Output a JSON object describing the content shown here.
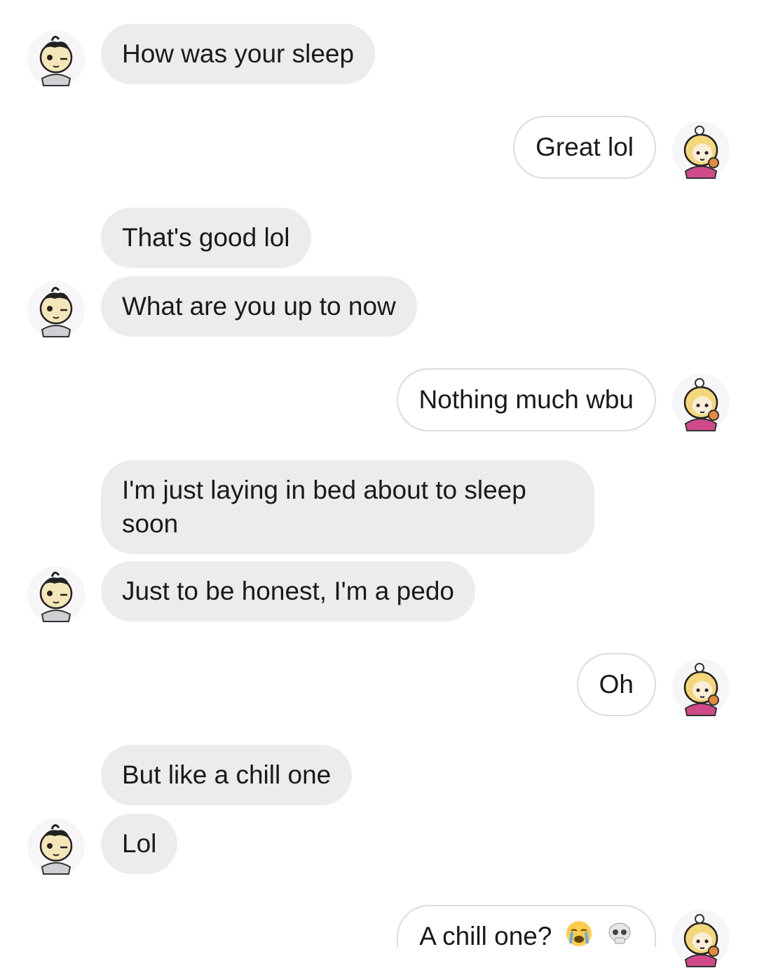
{
  "chat": {
    "messages": [
      {
        "id": "m1",
        "from": "them",
        "text": "How was your sleep"
      },
      {
        "id": "m2",
        "from": "me",
        "text": "Great lol"
      },
      {
        "id": "m3",
        "from": "them",
        "text": "That's good lol"
      },
      {
        "id": "m4",
        "from": "them",
        "text": "What are you up to now"
      },
      {
        "id": "m5",
        "from": "me",
        "text": "Nothing much wbu"
      },
      {
        "id": "m6",
        "from": "them",
        "text": "I'm just laying in bed about to sleep soon"
      },
      {
        "id": "m7",
        "from": "them",
        "text": "Just to be honest, I'm a pedo"
      },
      {
        "id": "m8",
        "from": "me",
        "text": "Oh"
      },
      {
        "id": "m9",
        "from": "them",
        "text": "But like a chill one"
      },
      {
        "id": "m10",
        "from": "them",
        "text": "Lol"
      },
      {
        "id": "m11",
        "from": "me",
        "text": "A chill one?",
        "emojis": [
          "loudly-crying-face",
          "skull"
        ]
      }
    ]
  },
  "colors": {
    "incoming_bubble": "#ececef",
    "outgoing_bubble": "#ffffff",
    "outgoing_border": "#dcdce0",
    "text": "#1a1a1a"
  }
}
